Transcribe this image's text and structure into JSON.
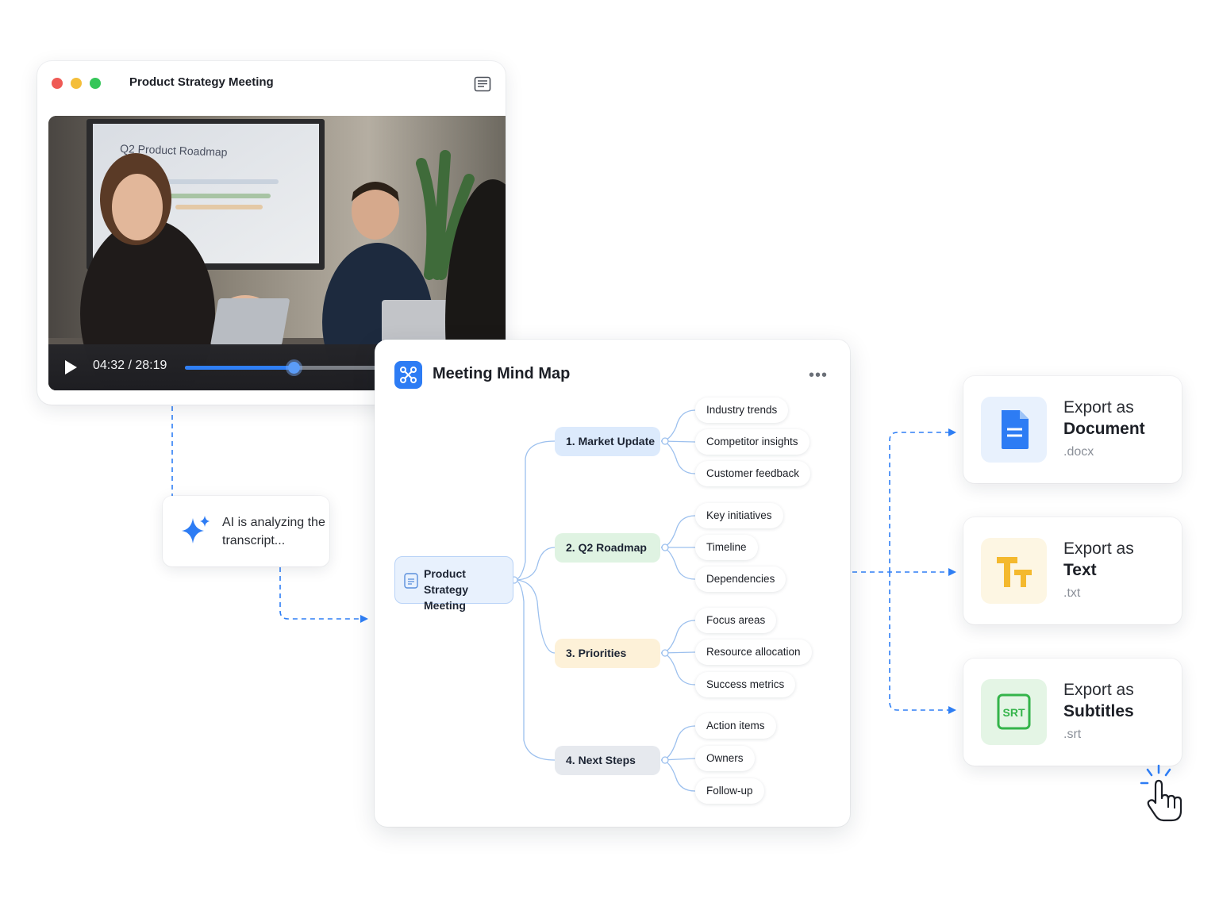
{
  "video_window": {
    "title": "Product Strategy Meeting",
    "slide_text": "Q2 Product Roadmap",
    "timecode": "04:32 / 28:19",
    "progress_fraction": 0.34
  },
  "ai_status": {
    "text": "AI is analyzing the transcript..."
  },
  "mind_map": {
    "title": "Meeting Mind Map",
    "more_label": "•••",
    "root": "Product Strategy Meeting",
    "branches": [
      {
        "label": "1. Market Update",
        "leaves": [
          "Industry trends",
          "Competitor insights",
          "Customer feedback"
        ]
      },
      {
        "label": "2. Q2 Roadmap",
        "leaves": [
          "Key initiatives",
          "Timeline",
          "Dependencies"
        ]
      },
      {
        "label": "3. Priorities",
        "leaves": [
          "Focus areas",
          "Resource allocation",
          "Success metrics"
        ]
      },
      {
        "label": "4. Next Steps",
        "leaves": [
          "Action items",
          "Owners",
          "Follow-up"
        ]
      }
    ]
  },
  "exports": [
    {
      "line1": "Export as",
      "line2": "Document",
      "ext": ".docx",
      "icon": "document-icon",
      "color": "#2d7cf4"
    },
    {
      "line1": "Export as",
      "line2": "Text",
      "ext": ".txt",
      "icon": "text-format-icon",
      "color": "#f4b92e"
    },
    {
      "line1": "Export as",
      "line2": "Subtitles",
      "ext": ".srt",
      "icon": "srt-subtitles-icon",
      "icon_text": "SRT",
      "color": "#34b44a"
    }
  ],
  "colors": {
    "accent": "#2d7cf4",
    "connector": "#2f7ff5"
  }
}
